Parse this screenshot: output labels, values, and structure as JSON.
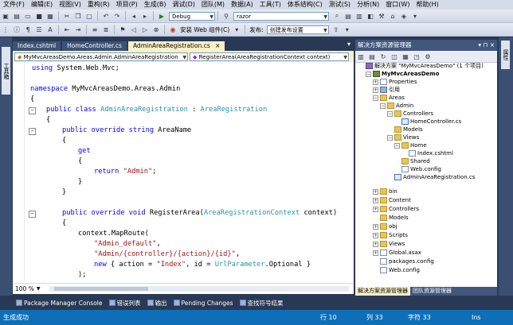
{
  "menu": [
    "文件(F)",
    "编辑(E)",
    "视图(V)",
    "重构(R)",
    "项目(P)",
    "生成(B)",
    "调试(D)",
    "团队(M)",
    "数据(A)",
    "工具(T)",
    "体系结构(C)",
    "测试(S)",
    "分析(N)",
    "窗口(W)",
    "帮助(H)"
  ],
  "toolbar": {
    "config": "Debug",
    "search": "razor",
    "install_web_components": "安装 Web 组件(C)",
    "publish_label": "发布:",
    "publish_profile": "创建发布设置"
  },
  "left_strip": {
    "toolbox": "工具箱"
  },
  "right_strip": {
    "properties": "属性"
  },
  "tabs": [
    {
      "label": "Index.cshtml"
    },
    {
      "label": "HomeController.cs"
    },
    {
      "label": "AdminAreaRegistration.cs"
    }
  ],
  "navbar": {
    "type": "MyMvcAreasDemo.Areas.Admin.AdminAreaRegistration",
    "member": "RegisterArea(AreaRegistrationContext context)"
  },
  "code": {
    "l1": {
      "a": "using",
      "b": " System.Web.Mvc;"
    },
    "l2": {
      "a": "namespace",
      "b": " MyMvcAreasDemo.Areas.Admin"
    },
    "l3": "{",
    "l4": {
      "a": "public class ",
      "b": "AdminAreaRegistration",
      "c": " : ",
      "d": "AreaRegistration"
    },
    "l5": "{",
    "l6": {
      "a": "public override string",
      "b": " AreaName"
    },
    "l7": "{",
    "l8": "get",
    "l9": "{",
    "l10": {
      "a": "return ",
      "b": "\"Admin\"",
      "c": ";"
    },
    "l11": "}",
    "l12": "}",
    "l13": {
      "a": "public override void",
      "b": " RegisterArea(",
      "c": "AreaRegistrationContext",
      "d": " context)"
    },
    "l14": "{",
    "l15": "context.MapRoute(",
    "l16": {
      "a": "\"Admin_default\"",
      "b": ","
    },
    "l17": {
      "a": "\"Admin/{controller}/{action}/{id}\"",
      "b": ","
    },
    "l18": {
      "a": "new",
      "b": " { action = ",
      "c": "\"Index\"",
      "d": ", id = ",
      "e": "UrlParameter",
      "f": ".Optional }"
    },
    "l19": ");",
    "l20": "}",
    "l21": "}"
  },
  "zoom": "100 %",
  "solution_explorer": {
    "title": "解决方案资源管理器",
    "controls": "▾ ⊓ ×",
    "tree": [
      {
        "label": "解决方案 \"MyMvcAreasDemo\" (1 个项目)",
        "icon": "sln"
      },
      {
        "label": "MyMvcAreasDemo",
        "icon": "proj"
      },
      {
        "label": "Properties",
        "icon": "file"
      },
      {
        "label": "引用",
        "icon": "ref"
      },
      {
        "label": "Areas",
        "icon": "folder"
      },
      {
        "label": "Admin",
        "icon": "folder"
      },
      {
        "label": "Controllers",
        "icon": "folder"
      },
      {
        "label": "HomeController.cs",
        "icon": "cs"
      },
      {
        "label": "Models",
        "icon": "folder"
      },
      {
        "label": "Views",
        "icon": "folder"
      },
      {
        "label": "Home",
        "icon": "folder"
      },
      {
        "label": "Index.cshtml",
        "icon": "file"
      },
      {
        "label": "Shared",
        "icon": "folder"
      },
      {
        "label": "Web.config",
        "icon": "file"
      },
      {
        "label": "AdminAreaRegistration.cs",
        "icon": "cs"
      },
      {
        "label": "bin",
        "icon": "folder"
      },
      {
        "label": "Content",
        "icon": "folder"
      },
      {
        "label": "Controllers",
        "icon": "folder"
      },
      {
        "label": "Models",
        "icon": "folder"
      },
      {
        "label": "obj",
        "icon": "folder"
      },
      {
        "label": "Scripts",
        "icon": "folder"
      },
      {
        "label": "Views",
        "icon": "folder"
      },
      {
        "label": "Global.asax",
        "icon": "file"
      },
      {
        "label": "packages.config",
        "icon": "file"
      },
      {
        "label": "Web.config",
        "icon": "file"
      }
    ],
    "bottom_tabs": [
      "解决方案资源管理器",
      "团队资源管理器"
    ]
  },
  "bottom_tabs": [
    "Package Manager Console",
    "错误列表",
    "输出",
    "Pending Changes",
    "查找符号结果"
  ],
  "status": {
    "message": "生成成功",
    "line": "行 10",
    "col": "列 33",
    "char": "字符 33",
    "ins": "Ins"
  }
}
